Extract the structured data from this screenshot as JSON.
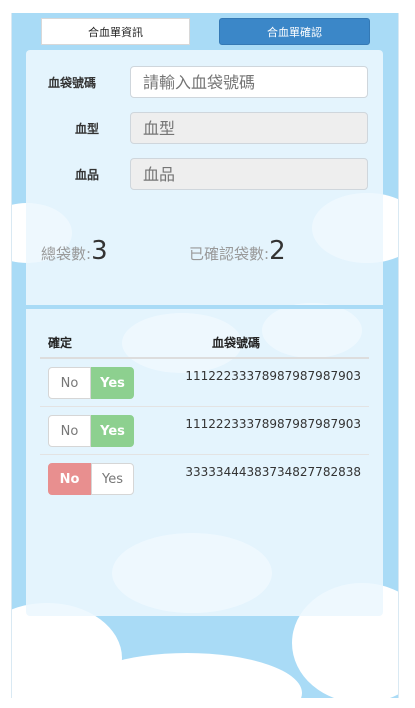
{
  "tabs": {
    "info_label": "合血單資訊",
    "confirm_label": "合血單確認",
    "active": "confirm"
  },
  "form": {
    "bag_code_label": "血袋號碼",
    "bag_code_placeholder": "請輸入血袋號碼",
    "blood_type_label": "血型",
    "blood_type_placeholder": "血型",
    "product_label": "血品",
    "product_placeholder": "血品"
  },
  "counts": {
    "total_label": "總袋數:",
    "total_value": "3",
    "confirmed_label": "已確認袋數:",
    "confirmed_value": "2"
  },
  "table": {
    "headers": {
      "confirm": "確定",
      "bag_code": "血袋號碼"
    },
    "toggle_labels": {
      "no": "No",
      "yes": "Yes"
    },
    "rows": [
      {
        "confirmed": "Yes",
        "bag_code": "1112223337898798798 7903"
      },
      {
        "confirmed": "Yes",
        "bag_code": "1112223337898798798 7903"
      },
      {
        "confirmed": "No",
        "bag_code": "3333344438373482778 2838"
      }
    ]
  },
  "colors": {
    "sky": "#a9dbf6",
    "active_tab": "#3b87c8",
    "yes_green": "#8dd08f",
    "no_red": "#e88f8f"
  }
}
